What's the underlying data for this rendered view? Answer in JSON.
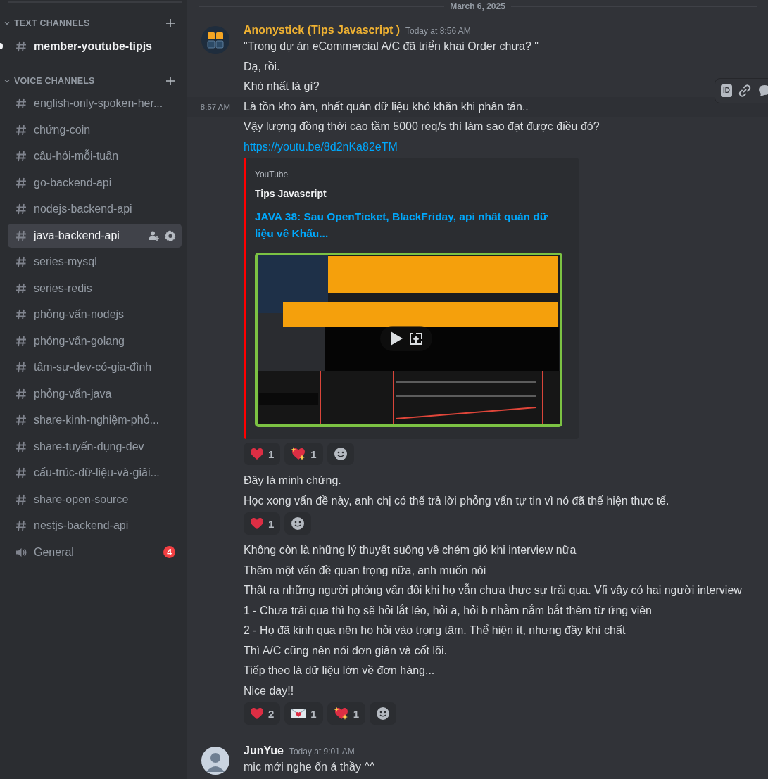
{
  "sidebar": {
    "sections": [
      {
        "title": "TEXT CHANNELS",
        "expanded": true,
        "channels": [
          {
            "name": "member-youtube-tipjs",
            "kind": "text",
            "selected": false,
            "unread": true
          }
        ]
      },
      {
        "title": "VOICE CHANNELS",
        "expanded": true,
        "channels": [
          {
            "name": "english-only-spoken-her...",
            "kind": "text",
            "selected": false,
            "unread": false
          },
          {
            "name": "chứng-coin",
            "kind": "text",
            "selected": false,
            "unread": false
          },
          {
            "name": "câu-hỏi-mỗi-tuần",
            "kind": "text",
            "selected": false,
            "unread": false
          },
          {
            "name": "go-backend-api",
            "kind": "text",
            "selected": false,
            "unread": false
          },
          {
            "name": "nodejs-backend-api",
            "kind": "text",
            "selected": false,
            "unread": false
          },
          {
            "name": "java-backend-api",
            "kind": "text",
            "selected": true,
            "unread": false
          },
          {
            "name": "series-mysql",
            "kind": "text",
            "selected": false,
            "unread": false
          },
          {
            "name": "series-redis",
            "kind": "text",
            "selected": false,
            "unread": false
          },
          {
            "name": "phỏng-vấn-nodejs",
            "kind": "text",
            "selected": false,
            "unread": false
          },
          {
            "name": "phỏng-vấn-golang",
            "kind": "text",
            "selected": false,
            "unread": false
          },
          {
            "name": "tâm-sự-dev-có-gia-đình",
            "kind": "text",
            "selected": false,
            "unread": false
          },
          {
            "name": "phỏng-vấn-java",
            "kind": "text",
            "selected": false,
            "unread": false
          },
          {
            "name": "share-kinh-nghiệm-phỏ...",
            "kind": "text",
            "selected": false,
            "unread": false
          },
          {
            "name": "share-tuyển-dụng-dev",
            "kind": "text",
            "selected": false,
            "unread": false
          },
          {
            "name": "cấu-trúc-dữ-liệu-và-giải...",
            "kind": "text",
            "selected": false,
            "unread": false
          },
          {
            "name": "share-open-source",
            "kind": "text",
            "selected": false,
            "unread": false
          },
          {
            "name": "nestjs-backend-api",
            "kind": "text",
            "selected": false,
            "unread": false
          },
          {
            "name": "General",
            "kind": "voice",
            "selected": false,
            "unread": false,
            "badge": "4"
          }
        ]
      }
    ]
  },
  "chat": {
    "date_divider": "March 6, 2025",
    "hover_toolbar": {
      "id_label": "ID"
    },
    "messages": [
      {
        "author": "Anonystick (Tips Javascript )",
        "color": "#f0b232",
        "time": "Today at 8:56 AM",
        "blocks": [
          {
            "kind": "line",
            "text": "\"Trong dự án eCommercial A/C đã triển khai Order chưa? \"",
            "hovered": false
          },
          {
            "kind": "line",
            "text": "Dạ, rồi.",
            "hovered": false
          },
          {
            "kind": "line",
            "text": "Khó nhất là gì?",
            "hovered": false
          },
          {
            "kind": "line",
            "text": "Là tồn kho âm, nhất quán dữ liệu khó khăn khi phân tán..",
            "hovered": true,
            "time": "8:57 AM"
          },
          {
            "kind": "line",
            "text": "Vậy lượng đồng thời cao tầm 5000 req/s thì làm sao đạt được điều đó?",
            "hovered": false
          },
          {
            "kind": "link",
            "text": "https://youtu.be/8d2nKa82eTM",
            "hovered": false
          },
          {
            "kind": "embed",
            "provider": "YouTube",
            "author": "Tips Javascript",
            "title": "JAVA 38: Sau OpenTicket, BlackFriday, api nhất quán dữ liệu về Khấu..."
          },
          {
            "kind": "reactions",
            "items": [
              {
                "kind": "heart",
                "count": "1"
              },
              {
                "kind": "sparkling_heart",
                "count": "1"
              }
            ]
          },
          {
            "kind": "line",
            "text": "Đây là minh chứng.",
            "hovered": false
          },
          {
            "kind": "line",
            "text": "Học xong vấn đề này, anh chị có thể trả lời phỏng vấn tự tin vì nó đã thể hiện thực tế.",
            "hovered": false
          },
          {
            "kind": "reactions",
            "items": [
              {
                "kind": "heart",
                "count": "1"
              }
            ]
          },
          {
            "kind": "line",
            "text": "Không còn là những lý thuyết suống về chém gió khi interview nữa",
            "hovered": false
          },
          {
            "kind": "line",
            "text": "Thêm một vấn đề quan trọng nữa, anh muốn nói",
            "hovered": false
          },
          {
            "kind": "line",
            "text": "Thật ra những người phỏng vấn đôi khi họ vẫn chưa thực sự trải qua. Vfi vậy có hai người interview",
            "hovered": false
          },
          {
            "kind": "line",
            "text": "1 - Chưa trải qua thì họ sẽ hỏi lắt léo, hỏi a, hỏi b nhằm nắm bắt thêm từ ứng viên",
            "hovered": false
          },
          {
            "kind": "line",
            "text": "2 - Họ đã kinh qua nên họ hỏi vào trọng tâm. Thể hiện ít, nhưng đầy khí chất",
            "hovered": false
          },
          {
            "kind": "line",
            "text": "Thì A/C cũng nên nói đơn giản và cốt lõi.",
            "hovered": false
          },
          {
            "kind": "line",
            "text": "Tiếp theo là dữ liệu lớn về đơn hàng...",
            "hovered": false
          },
          {
            "kind": "line",
            "text": "Nice day!!",
            "hovered": false
          },
          {
            "kind": "reactions",
            "items": [
              {
                "kind": "heart",
                "count": "2"
              },
              {
                "kind": "love_letter",
                "count": "1"
              },
              {
                "kind": "sparkling_heart",
                "count": "1"
              }
            ]
          }
        ]
      },
      {
        "author": "JunYue",
        "color": "#f2f3f5",
        "time": "Today at 9:01 AM",
        "blocks": [
          {
            "kind": "line",
            "text": "mic mới nghe ổn á thầy ^^",
            "hovered": false
          }
        ]
      }
    ]
  }
}
